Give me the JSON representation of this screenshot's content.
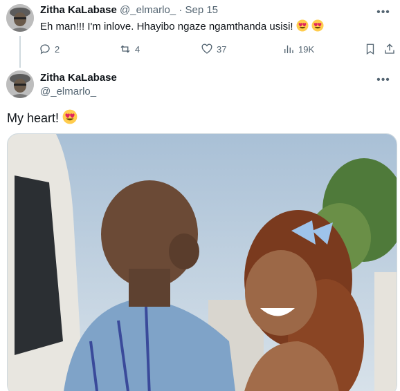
{
  "tweet1": {
    "author_name": "Zitha KaLabase",
    "handle": "@_elmarlo_",
    "separator": "·",
    "date": "Sep 15",
    "text": "Eh man!!! I'm inlove. Hhayibo ngaze ngamthanda usisi!",
    "emoji": "heart-eyes",
    "more_icon": "more-icon",
    "actions": {
      "replies": "2",
      "reposts": "4",
      "likes": "37",
      "views": "19K"
    }
  },
  "tweet2": {
    "author_name": "Zitha KaLabase",
    "handle": "@_elmarlo_",
    "text": "My heart!",
    "emoji": "heart-eyes",
    "more_icon": "more-icon"
  },
  "colors": {
    "text_primary": "#0f1419",
    "text_secondary": "#536471",
    "border": "#cfd9de",
    "emoji_face": "#ffcc4d",
    "emoji_heart": "#e0245e"
  }
}
